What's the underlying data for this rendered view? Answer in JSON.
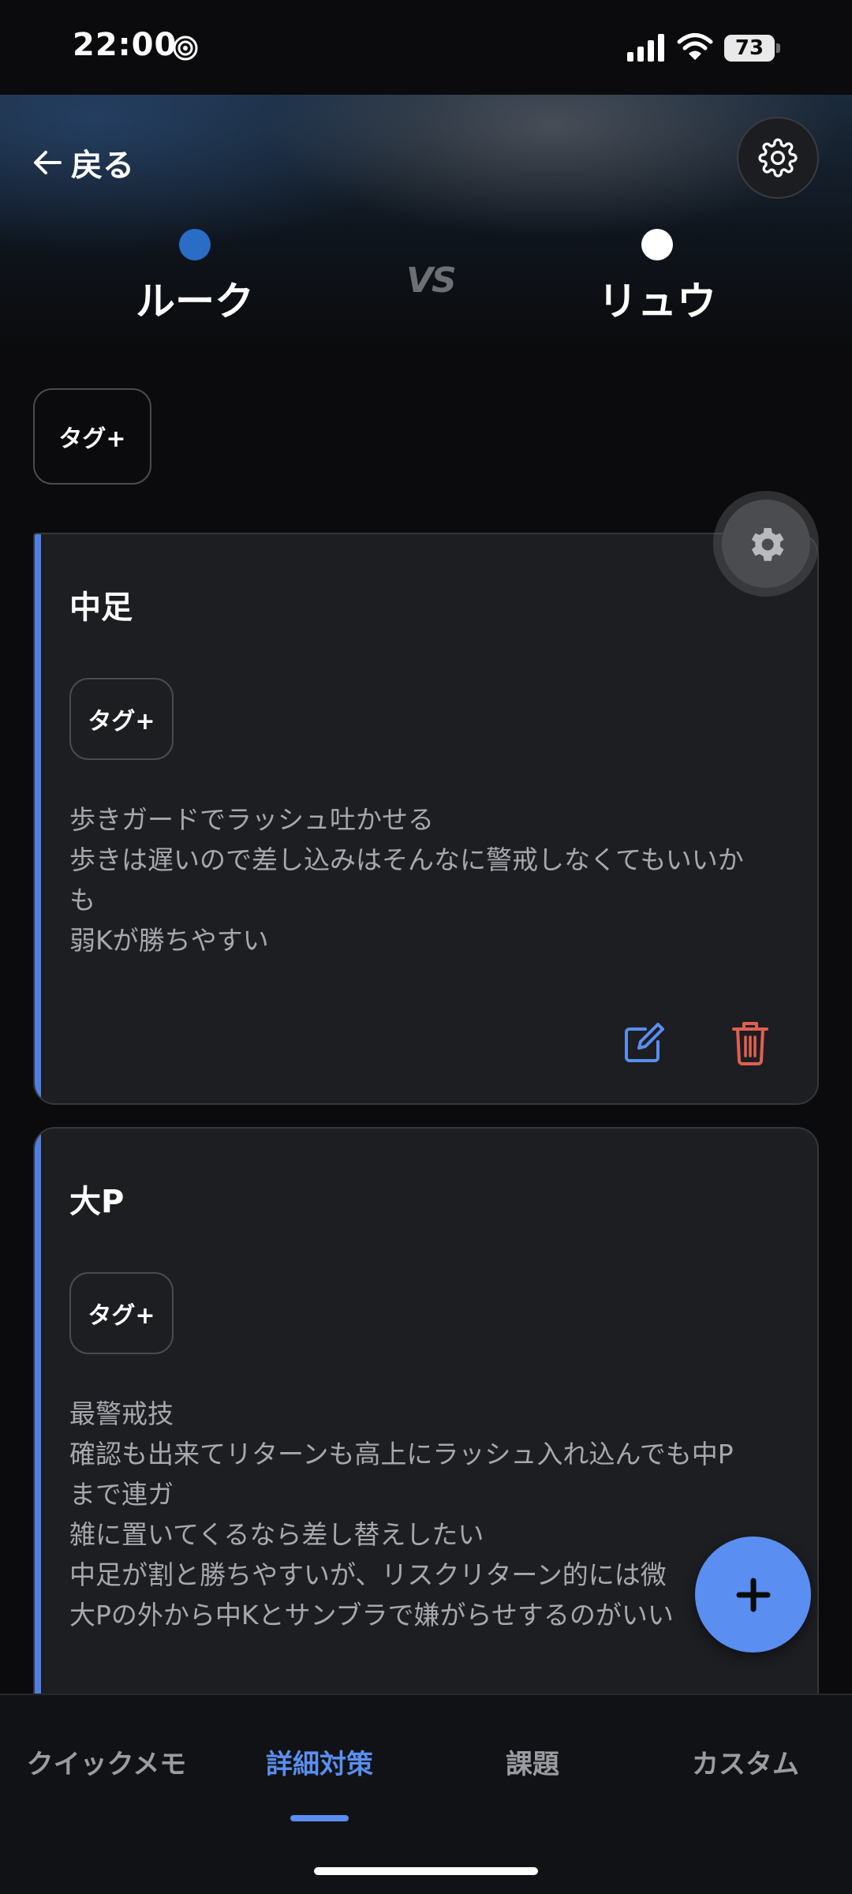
{
  "status_bar": {
    "time": "22:00",
    "battery": "73"
  },
  "header": {
    "back_label": "戻る",
    "player_left": {
      "name": "ルーク",
      "color": "#2b6cc4"
    },
    "vs": "VS",
    "player_right": {
      "name": "リュウ",
      "color": "#ffffff"
    }
  },
  "tag_button_label": "タグ+",
  "cards": [
    {
      "title": "中足",
      "tag_label": "タグ+",
      "lines": [
        "歩きガードでラッシュ吐かせる",
        "歩きは遅いので差し込みはそんなに警戒しなくてもいいか",
        "も",
        "弱Kが勝ちやすい"
      ]
    },
    {
      "title": "大P",
      "tag_label": "タグ+",
      "lines": [
        "最警戒技",
        "確認も出来てリターンも高上にラッシュ入れ込んでも中P",
        "まで連ガ",
        "雑に置いてくるなら差し替えしたい",
        "中足が割と勝ちやすいが、リスクリターン的には微",
        "大Pの外から中Kとサンブラで嫌がらせするのがいい"
      ]
    }
  ],
  "nav": {
    "tabs": [
      "クイックメモ",
      "詳細対策",
      "課題",
      "カスタム"
    ],
    "active_index": 1
  },
  "colors": {
    "accent": "#5a8ef0",
    "delete": "#e0604f",
    "card_bg": "#1d1e22"
  }
}
